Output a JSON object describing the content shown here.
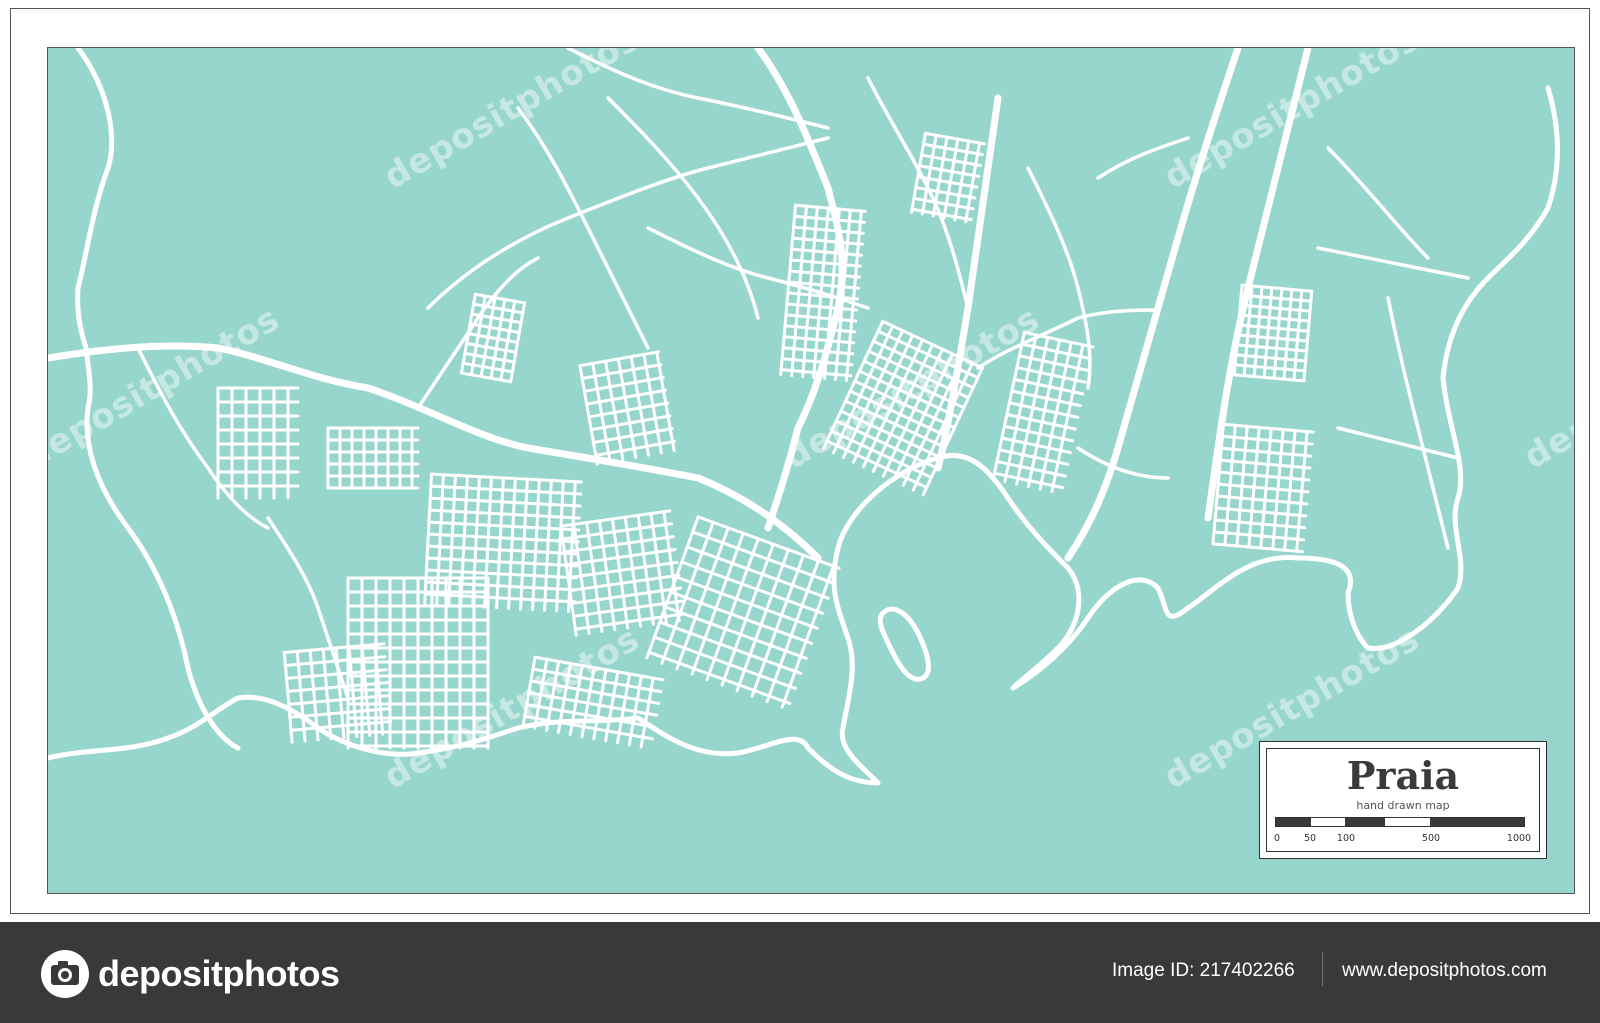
{
  "map": {
    "city": "Praia",
    "subtitle": "hand drawn map",
    "colors": {
      "water": "#97d6cd",
      "roads": "#ffffff",
      "border": "#555555",
      "text": "#3a3a3a"
    },
    "scale": {
      "ticks": [
        "0",
        "50",
        "100",
        "500",
        "1000"
      ]
    }
  },
  "watermark": {
    "text": "depositphotos"
  },
  "footer": {
    "brand": "depositphotos",
    "logo_icon": "camera-icon",
    "image_id": "Image ID: 217402266",
    "url": "www.depositphotos.com"
  }
}
